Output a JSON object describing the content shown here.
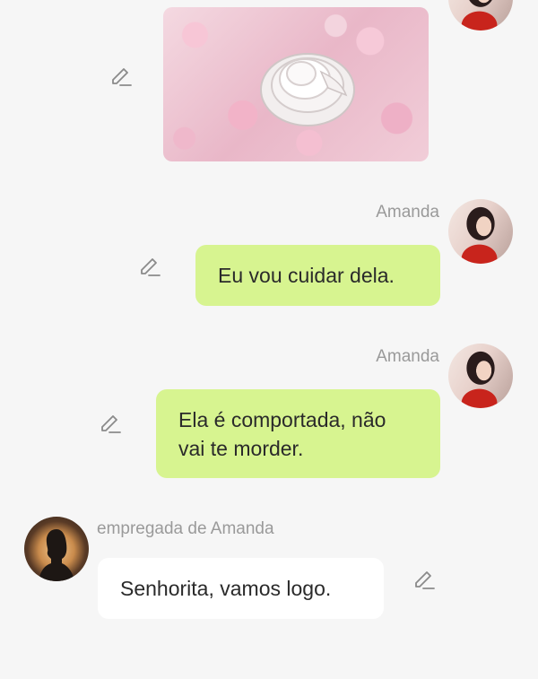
{
  "messages": [
    {
      "type": "image",
      "side": "right",
      "sender": "",
      "image_alt": "white snake coiled on pink petals"
    },
    {
      "type": "text",
      "side": "right",
      "sender": "Amanda",
      "text": "Eu vou cuidar dela."
    },
    {
      "type": "text",
      "side": "right",
      "sender": "Amanda",
      "text_line1": "Ela é comportada, não",
      "text_line2": "vai te morder."
    },
    {
      "type": "text",
      "side": "left",
      "sender": "empregada de Amanda",
      "text": "Senhorita, vamos logo."
    }
  ],
  "icons": {
    "edit": "pencil-icon",
    "avatar_amanda": "woman-portrait",
    "avatar_maid": "silhouette-portrait"
  },
  "colors": {
    "background": "#f6f6f6",
    "user_bubble": "#d7f490",
    "other_bubble": "#ffffff",
    "name_text": "#9a9a9a",
    "message_text": "#2a2a2a"
  }
}
